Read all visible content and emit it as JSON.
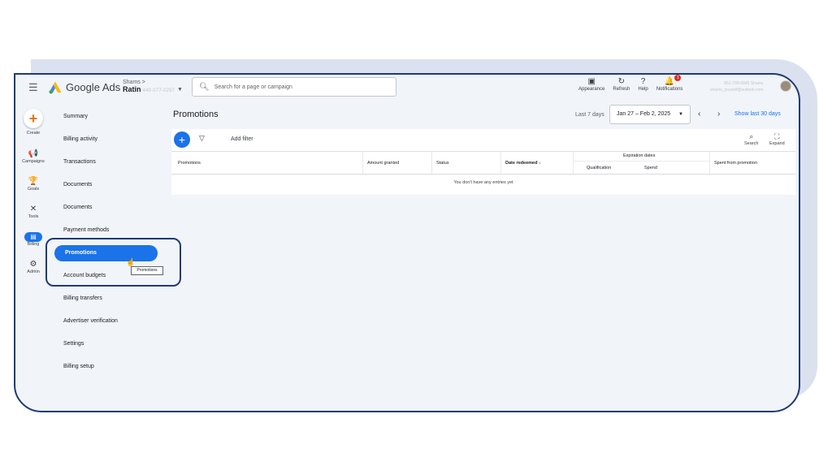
{
  "topbar": {
    "app_name": "Google Ads",
    "account_line1": "Shams",
    "account_name": "Ratin",
    "account_id": "449-077-0297",
    "search_placeholder": "Search for a page or campaign",
    "icons": [
      {
        "name": "appearance-icon",
        "label": "Appearance",
        "glyph": "▣"
      },
      {
        "name": "refresh-icon",
        "label": "Refresh",
        "glyph": "↻"
      },
      {
        "name": "help-icon",
        "label": "Help",
        "glyph": "?"
      },
      {
        "name": "notifications-icon",
        "label": "Notifications",
        "glyph": "🔔"
      }
    ],
    "notification_count": "1",
    "user_phone": "851-799-6845 Shams",
    "user_email": "shams_youself@outlook.com"
  },
  "rail": {
    "create": "Create",
    "items": [
      {
        "label": "Campaigns",
        "glyph": "📢"
      },
      {
        "label": "Goals",
        "glyph": "🏆"
      },
      {
        "label": "Tools",
        "glyph": "✕"
      },
      {
        "label": "Billing",
        "glyph": "▤"
      },
      {
        "label": "Admin",
        "glyph": "⚙"
      }
    ]
  },
  "nav": {
    "items": [
      "Summary",
      "Billing activity",
      "Transactions",
      "Documents",
      "Documents",
      "Payment methods",
      "Promotions",
      "Account budgets",
      "Billing transfers",
      "Advertiser verification",
      "Settings",
      "Billing setup"
    ],
    "tooltip": "Promotions"
  },
  "main": {
    "title": "Promotions",
    "date_label": "Last 7 days",
    "date_range": "Jan 27 – Feb 2, 2025",
    "show_last": "Show last 30 days",
    "add_filter": "Add filter",
    "search_label": "Search",
    "expand_label": "Expand",
    "table": {
      "col_promotions": "Promotions",
      "col_amount": "Amount granted",
      "col_status": "Status",
      "col_date": "Date redeemed",
      "col_expiration": "Expiration dates",
      "col_qualification": "Qualification",
      "col_spend": "Spend",
      "col_spent": "Spent from promotion",
      "empty": "You don't have any entries yet"
    }
  },
  "colors": {
    "accent": "#1a73e8",
    "frame": "#1f3a78",
    "background": "#f1f4f9"
  }
}
